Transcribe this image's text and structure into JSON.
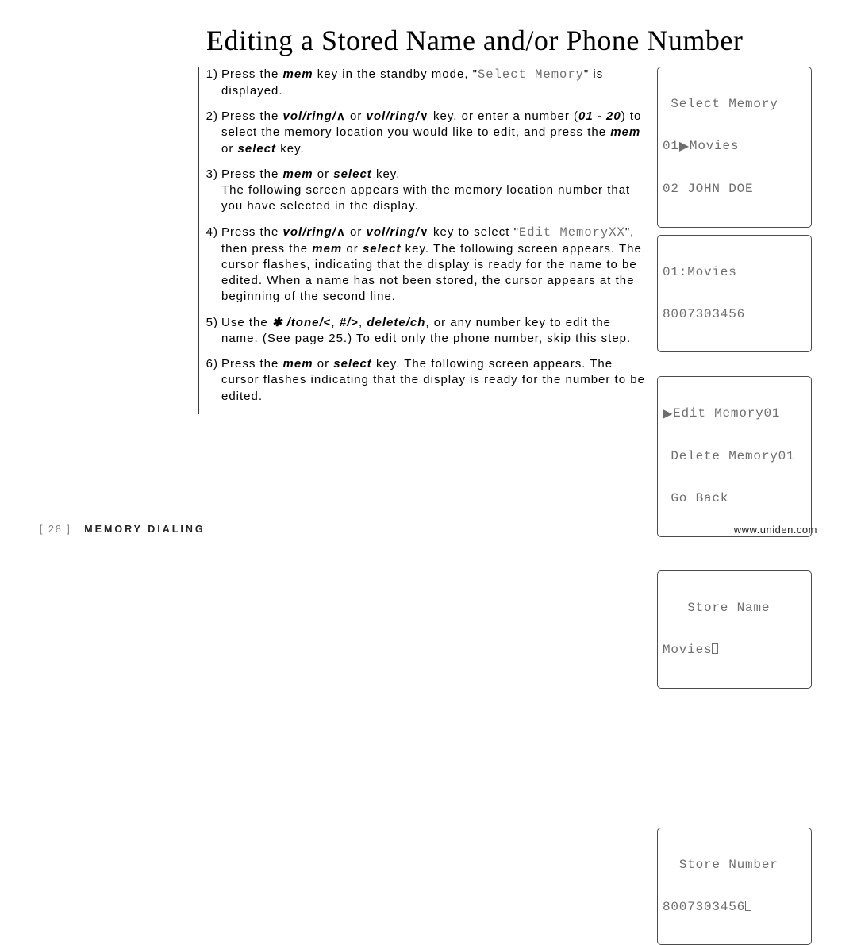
{
  "title": "Editing a Stored Name and/or Phone Number",
  "steps": {
    "s1": {
      "num": "1)",
      "a": "Press the ",
      "k1": "mem",
      "b": " key in the standby mode, \"",
      "lcd": "Select Memory",
      "c": "\" is displayed."
    },
    "s2": {
      "num": "2)",
      "a": "Press the ",
      "k1": "vol/ring/",
      "arr1": "∧",
      "b": " or ",
      "k2": "vol/ring/",
      "arr2": "∨",
      "c": " key, or enter a number (",
      "rng": "01 - 20",
      "d": ") to select the memory location you would like to edit, and press the ",
      "k3": "mem",
      "e": " or ",
      "k4": "select",
      "f": " key."
    },
    "s3": {
      "num": "3)",
      "a": "Press the ",
      "k1": "mem",
      "b": " or ",
      "k2": "select",
      "c": " key.",
      "d": "The following screen appears with the memory location number that you have selected in the display."
    },
    "s4": {
      "num": "4)",
      "a": "Press the ",
      "k1": "vol/ring/",
      "arr1": "∧",
      "b": " or ",
      "k2": "vol/ring/",
      "arr2": "∨",
      "c": " key to select \"",
      "lcd": "Edit MemoryXX",
      "d": "\", then press the ",
      "k3": "mem",
      "e": " or ",
      "k4": "select",
      "f": " key. The following screen appears. The cursor flashes, indicating that the display is ready for the name to be edited. When a name has not been stored, the cursor appears at the beginning of the second line."
    },
    "s5": {
      "num": "5)",
      "a": "Use the ",
      "k1": " /tone/",
      "arr1": "<",
      "b": ", ",
      "k2": "#/",
      "arr2": ">",
      "c": ", ",
      "k3": "delete/ch",
      "d": ", or any number key to edit the name. (See page 25.) To edit only the phone number, skip this step."
    },
    "s6": {
      "num": "6)",
      "a": "Press the ",
      "k1": "mem",
      "b": " or ",
      "k2": "select",
      "c": " key. The following screen appears. The cursor flashes indicating that the display is ready for the number to be edited."
    }
  },
  "lcds": {
    "d1": {
      "l1": " Select Memory",
      "l2a": "01",
      "l2b": "Movies",
      "l3": "02 JOHN DOE"
    },
    "d2": {
      "l1": "01:Movies",
      "l2": "8007303456"
    },
    "d3": {
      "l1": "Edit Memory01",
      "l2": " Delete Memory01",
      "l3": " Go Back"
    },
    "d4": {
      "l1": "   Store Name",
      "l2": "Movies"
    },
    "d5": {
      "l1": "  Store Number",
      "l2": "8007303456"
    }
  },
  "footer": {
    "page": "[ 28 ]",
    "section": "MEMORY DIALING",
    "url": "www.uniden.com"
  }
}
